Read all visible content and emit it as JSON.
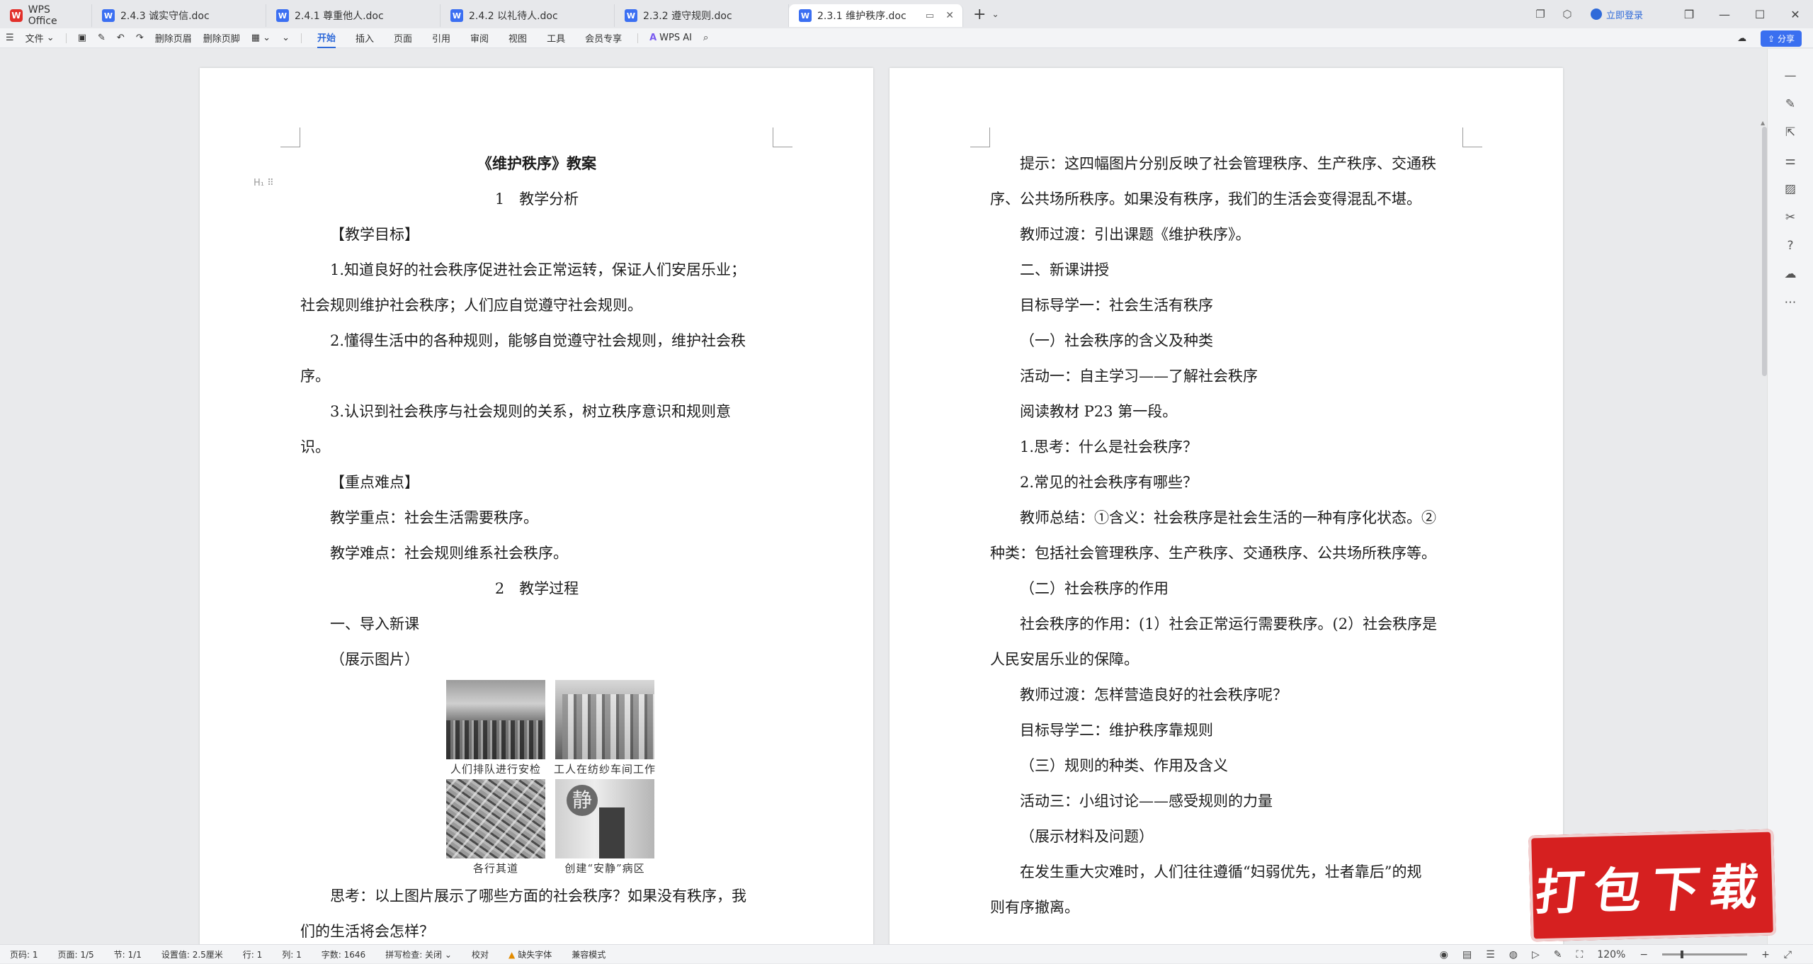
{
  "tabs": [
    {
      "label": "WPS Office",
      "type": "home"
    },
    {
      "label": "2.4.3 诚实守信.doc",
      "type": "doc"
    },
    {
      "label": "2.4.1 尊重他人.doc",
      "type": "doc"
    },
    {
      "label": "2.4.2 以礼待人.doc",
      "type": "doc"
    },
    {
      "label": "2.3.2 遵守规则.doc",
      "type": "doc"
    },
    {
      "label": "2.3.1 维护秩序.doc",
      "type": "doc",
      "active": true
    }
  ],
  "titlebar": {
    "login": "立即登录",
    "wps_mark": "W",
    "doc_mark": "W"
  },
  "ribbon": {
    "file": "文件",
    "delete_header": "删除页眉",
    "delete_footer": "删除页脚",
    "menus": [
      "开始",
      "插入",
      "页面",
      "引用",
      "审阅",
      "视图",
      "工具",
      "会员专享"
    ],
    "active_menu": "开始",
    "ai": "WPS AI",
    "share": "分享"
  },
  "left_page": {
    "title": "《维护秩序》教案",
    "sec1": "1　教学分析",
    "goal_head": "【教学目标】",
    "goal1a": "1.知道良好的社会秩序促进社会正常运转，保证人们安居乐业；",
    "goal1b": "社会规则维护社会秩序；人们应自觉遵守社会规则。",
    "goal2a": "2.懂得生活中的各种规则，能够自觉遵守社会规则，维护社会秩",
    "goal2b": "序。",
    "goal3a": "3.认识到社会秩序与社会规则的关系，树立秩序意识和规则意",
    "goal3b": "识。",
    "key_head": "【重点难点】",
    "key1": "教学重点：社会生活需要秩序。",
    "key2": "教学难点：社会规则维系社会秩序。",
    "sec2": "2　教学过程",
    "step1": "一、导入新课",
    "show_pic": "（展示图片）",
    "captions": [
      "人们排队进行安检",
      "工人在纺纱车间工作",
      "各行其道",
      "创建“安静”病区"
    ],
    "think1": "思考：以上图片展示了哪些方面的社会秩序？如果没有秩序，我",
    "think2": "们的生活将会怎样？"
  },
  "right_page": {
    "lines": [
      {
        "t": "提示：这四幅图片分别反映了社会管理秩序、生产秩序、交通秩",
        "indent": true
      },
      {
        "t": "序、公共场所秩序。如果没有秩序，我们的生活会变得混乱不堪。",
        "indent": false
      },
      {
        "t": "教师过渡：引出课题《维护秩序》。",
        "indent": true
      },
      {
        "t": "二、新课讲授",
        "indent": true
      },
      {
        "t": "目标导学一：社会生活有秩序",
        "indent": true
      },
      {
        "t": "（一）社会秩序的含义及种类",
        "indent": true
      },
      {
        "t": "活动一：自主学习——了解社会秩序",
        "indent": true
      },
      {
        "t": "阅读教材 P23 第一段。",
        "indent": true
      },
      {
        "t": "1.思考：什么是社会秩序？",
        "indent": true
      },
      {
        "t": "2.常见的社会秩序有哪些？",
        "indent": true
      },
      {
        "t": "教师总结：①含义：社会秩序是社会生活的一种有序化状态。②",
        "indent": true
      },
      {
        "t": "种类：包括社会管理秩序、生产秩序、交通秩序、公共场所秩序等。",
        "indent": false
      },
      {
        "t": "（二）社会秩序的作用",
        "indent": true
      },
      {
        "t": "社会秩序的作用：(1）社会正常运行需要秩序。(2）社会秩序是",
        "indent": true
      },
      {
        "t": "人民安居乐业的保障。",
        "indent": false
      },
      {
        "t": "教师过渡：怎样营造良好的社会秩序呢？",
        "indent": true
      },
      {
        "t": "目标导学二：维护秩序靠规则",
        "indent": true
      },
      {
        "t": "（三）规则的种类、作用及含义",
        "indent": true
      },
      {
        "t": "活动三：小组讨论——感受规则的力量",
        "indent": true
      },
      {
        "t": "（展示材料及问题）",
        "indent": true
      },
      {
        "t": "在发生重大灾难时，人们往往遵循“妇弱优先，壮者靠后”的规",
        "indent": true
      },
      {
        "t": "则有序撤离。",
        "indent": false
      }
    ]
  },
  "heading_marker": "H₁ ⠿",
  "download_badge": "打包下载",
  "statusbar": {
    "page_num": "页码: 1",
    "pages": "页面: 1/5",
    "section": "节: 1/1",
    "setting": "设置值: 2.5厘米",
    "row": "行: 1",
    "col": "列: 1",
    "words": "字数: 1646",
    "spell": "拼写检查: 关闭",
    "proof": "校对",
    "missing_font": "缺失字体",
    "compat": "兼容模式",
    "zoom": "120%"
  }
}
